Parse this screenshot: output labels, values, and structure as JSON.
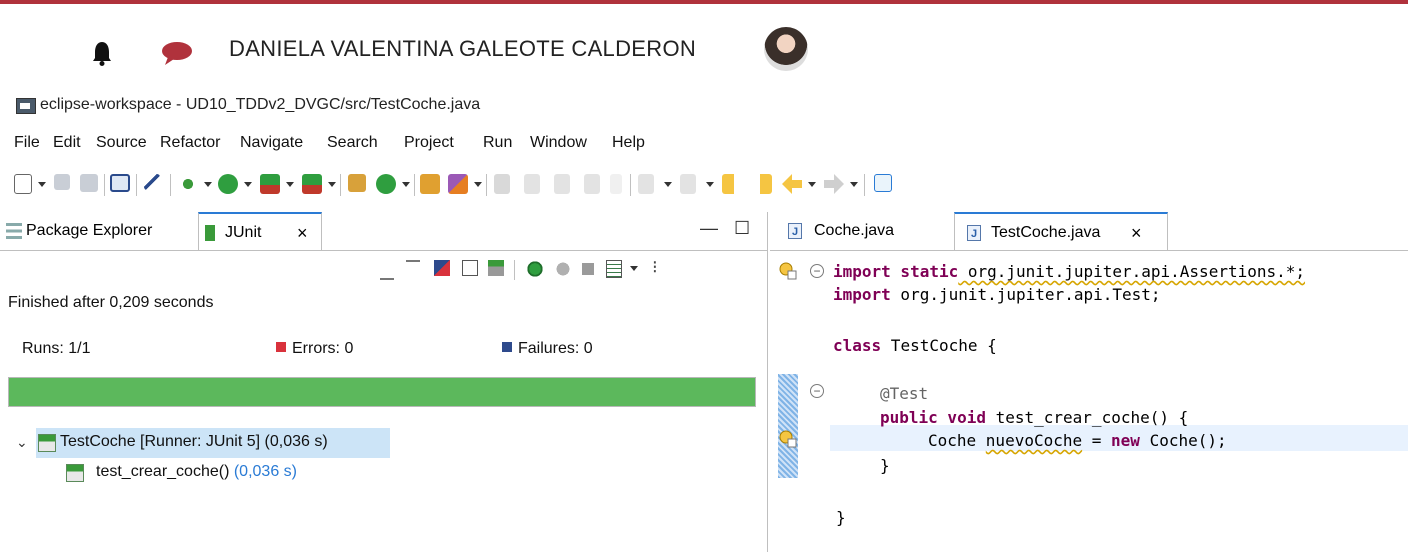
{
  "user": {
    "name": "DANIELA VALENTINA GALEOTE CALDERON"
  },
  "window": {
    "title": "eclipse-workspace - UD10_TDDv2_DVGC/src/TestCoche.java"
  },
  "menu": [
    "File",
    "Edit",
    "Source",
    "Refactor",
    "Navigate",
    "Search",
    "Project",
    "Run",
    "Window",
    "Help"
  ],
  "left_tabs": {
    "package_explorer": "Package Explorer",
    "junit": "JUnit",
    "close": "×",
    "minimize": "—",
    "maximize": "☐"
  },
  "junit": {
    "finished": "Finished after 0,209 seconds",
    "runs": "Runs:  1/1",
    "errors": "Errors:  0",
    "failures": "Failures:  0",
    "progress": 1.0,
    "progress_color": "#5cb85c",
    "tree": {
      "root_label": "TestCoche [Runner: JUnit 5] (0,036 s)",
      "child_name": "test_crear_coche()",
      "child_duration": "(0,036 s)"
    }
  },
  "editor": {
    "tabs": [
      {
        "label": "Coche.java"
      },
      {
        "label": "TestCoche.java",
        "close": "×"
      }
    ],
    "code": {
      "l1_kw": "import static",
      "l1_rest": " org.junit.jupiter.api.Assertions.*;",
      "l2_kw": "import",
      "l2_rest": " org.junit.jupiter.api.Test;",
      "l3_kw": "class",
      "l3_rest": " TestCoche {",
      "l4": "@Test",
      "l5_kw": "public void",
      "l5_rest": " test_crear_coche() {",
      "l6_a": "Coche ",
      "l6_var": "nuevoCoche",
      "l6_b": " = ",
      "l6_kw": "new",
      "l6_c": " Coche();",
      "l7": "}",
      "l8": "}"
    }
  },
  "colors": {
    "accent_red": "#b0323c",
    "selection": "#cce4f7",
    "keyword": "#7f0055",
    "tab_active": "#2a7bd5"
  }
}
